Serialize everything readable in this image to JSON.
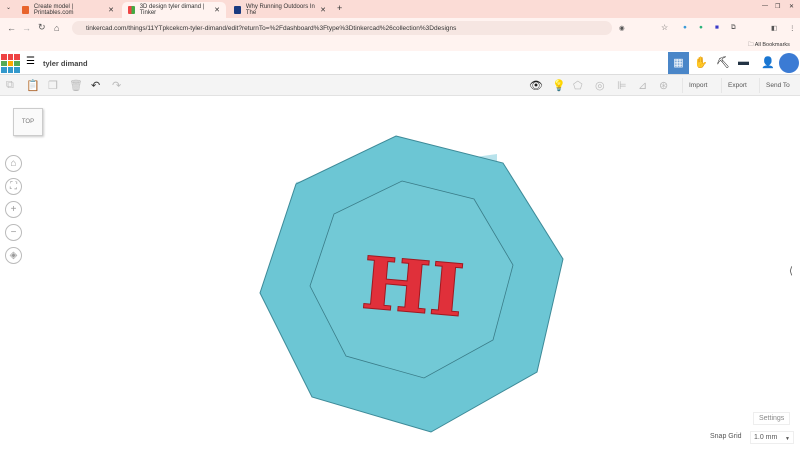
{
  "browser": {
    "tabs": [
      {
        "title": "Create model | Printables.com",
        "color": "#e8642c"
      },
      {
        "title": "3D design tyler dimand | Tinker",
        "color": "#5ba0d8"
      },
      {
        "title": "Why Running Outdoors In The",
        "color": "#1a3a80"
      }
    ],
    "new_tab": "+",
    "url": "tinkercad.com/things/11YTpkcekcm-tyler-dimand/edit?returnTo=%2Fdashboard%3Ftype%3Dtinkercad%26collection%3Ddesigns",
    "bookmarks_label": "All Bookmarks"
  },
  "app": {
    "logo": "TINKERCAD",
    "design_name": "tyler dimand",
    "accent": "#4a86c8",
    "toolbar": {
      "import": "Import",
      "export": "Export",
      "send_to": "Send To"
    },
    "view_cube": "TOP",
    "settings": "Settings",
    "snap_grid_label": "Snap Grid",
    "snap_grid_value": "1.0 mm"
  },
  "scene": {
    "text_shape": "HI",
    "text_color": "#e0303a",
    "plate_color": "#6cc6d4"
  }
}
